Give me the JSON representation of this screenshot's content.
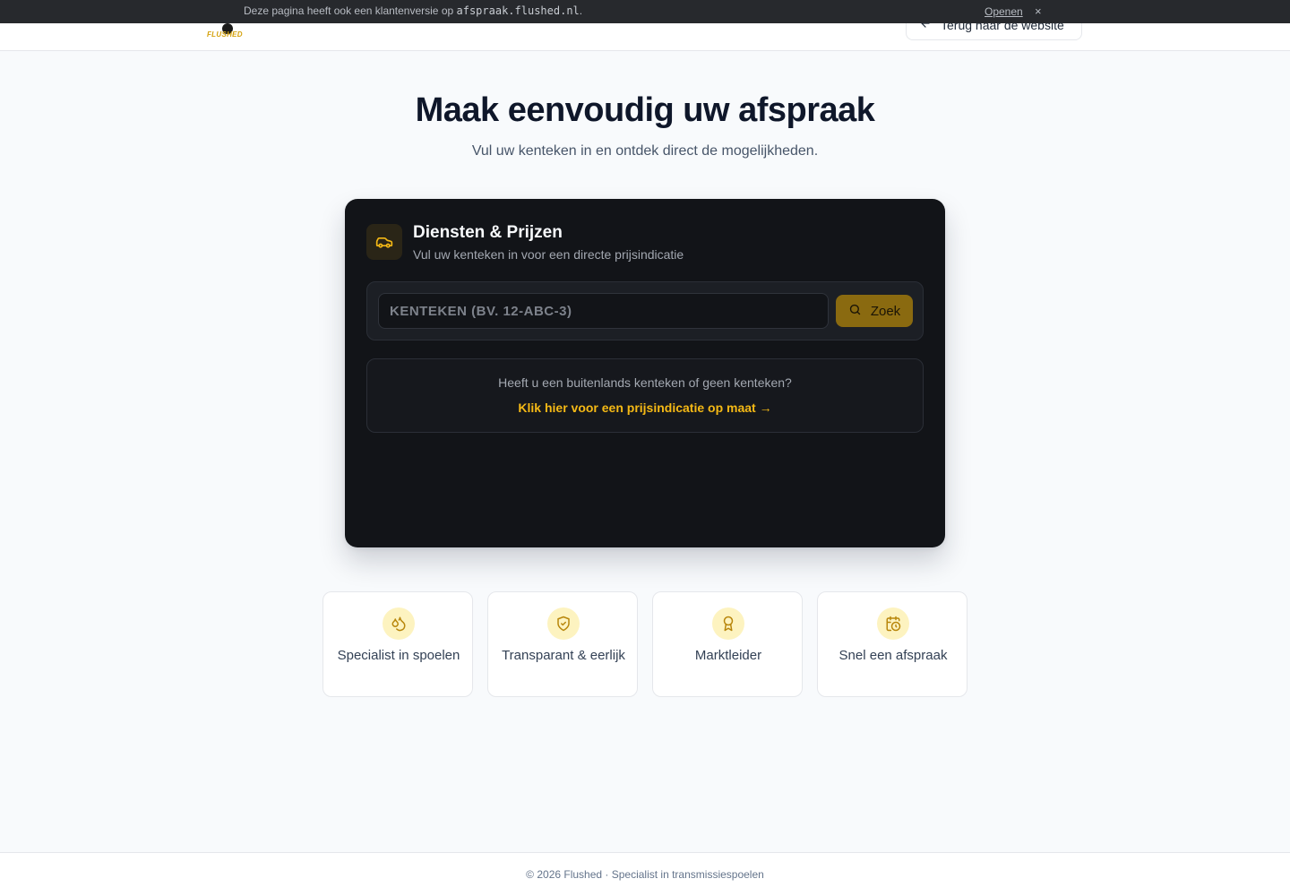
{
  "notice": {
    "text": "Deze pagina heeft ook een klantenversie op ",
    "domain": "afspraak.flushed.nl",
    "period": ".",
    "open_label": "Openen",
    "close_label": "×"
  },
  "header": {
    "logo_text": "FLUSHED",
    "back_label": "Terug naar de website",
    "back_icon": "arrow-left-icon"
  },
  "hero": {
    "title": "Maak eenvoudig uw afspraak",
    "subtitle": "Vul uw kenteken in en ontdek direct de mogelijkheden."
  },
  "card": {
    "icon": "car-icon",
    "title": "Diensten & Prijzen",
    "subtitle": "Vul uw kenteken in voor een directe prijsindicatie",
    "search": {
      "placeholder": "KENTEKEN (BV. 12-ABC-3)",
      "value": "",
      "button_label": "Zoek",
      "button_icon": "search-icon"
    },
    "foreign": {
      "text": "Heeft u een buitenlands kenteken of geen kenteken?",
      "link": "Klik hier voor een prijsindicatie op maat →"
    }
  },
  "features": [
    {
      "icon": "droplets-icon",
      "label": "Specialist in spoelen"
    },
    {
      "icon": "shield-check-icon",
      "label": "Transparant & eerlijk"
    },
    {
      "icon": "award-icon",
      "label": "Marktleider"
    },
    {
      "icon": "calendar-clock-icon",
      "label": "Snel een afspraak"
    }
  ],
  "footer": {
    "text": "© 2026 Flushed · Specialist in transmissiespoelen"
  },
  "colors": {
    "accent": "#f5b915",
    "button_bg": "#8a6a10",
    "card_bg": "#121418",
    "page_bg": "#f8fafc"
  }
}
